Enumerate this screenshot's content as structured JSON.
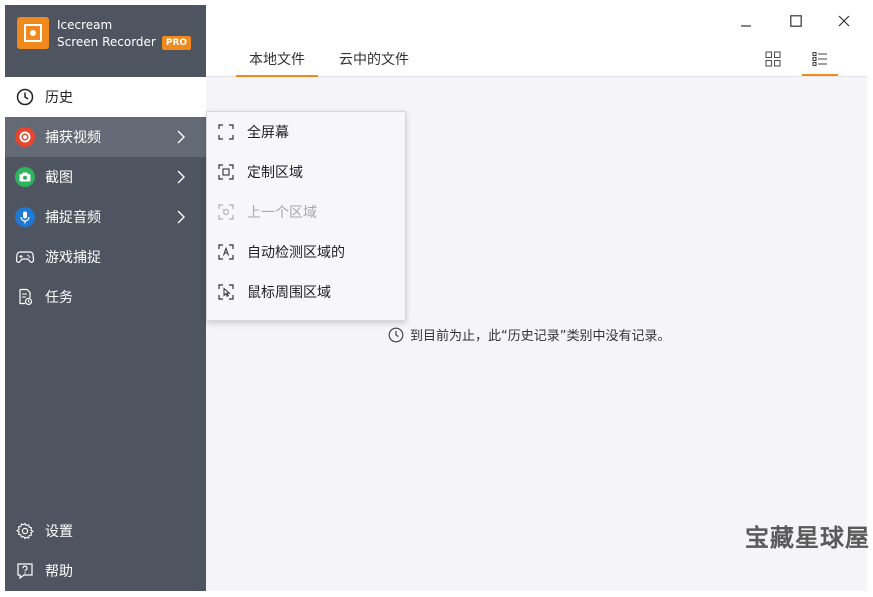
{
  "app": {
    "name_line1": "Icecream",
    "name_line2": "Screen Recorder",
    "badge": "PRO",
    "accent": "#f08a1c"
  },
  "sidebar": {
    "items": [
      {
        "label": "历史",
        "icon": "clock-icon"
      },
      {
        "label": "捕获视频",
        "icon": "record-icon",
        "color": "#e9452e"
      },
      {
        "label": "截图",
        "icon": "camera-icon",
        "color": "#2db35d"
      },
      {
        "label": "捕捉音频",
        "icon": "microphone-icon",
        "color": "#1f78d1"
      },
      {
        "label": "游戏捕捉",
        "icon": "gamepad-icon"
      },
      {
        "label": "任务",
        "icon": "task-icon"
      }
    ],
    "bottom": [
      {
        "label": "设置",
        "icon": "gear-icon"
      },
      {
        "label": "帮助",
        "icon": "help-icon"
      }
    ]
  },
  "tabs": [
    {
      "label": "本地文件"
    },
    {
      "label": "云中的文件"
    }
  ],
  "empty_message": "到目前为止，此“历史记录”类别中没有记录。",
  "submenu": {
    "items": [
      {
        "label": "全屏幕",
        "icon": "fullscreen-icon"
      },
      {
        "label": "定制区域",
        "icon": "custom-area-icon"
      },
      {
        "label": "上一个区域",
        "icon": "previous-area-icon",
        "disabled": true
      },
      {
        "label": "自动检测区域的",
        "icon": "auto-detect-icon"
      },
      {
        "label": "鼠标周围区域",
        "icon": "around-mouse-icon"
      }
    ]
  },
  "watermark": "宝藏星球屋"
}
